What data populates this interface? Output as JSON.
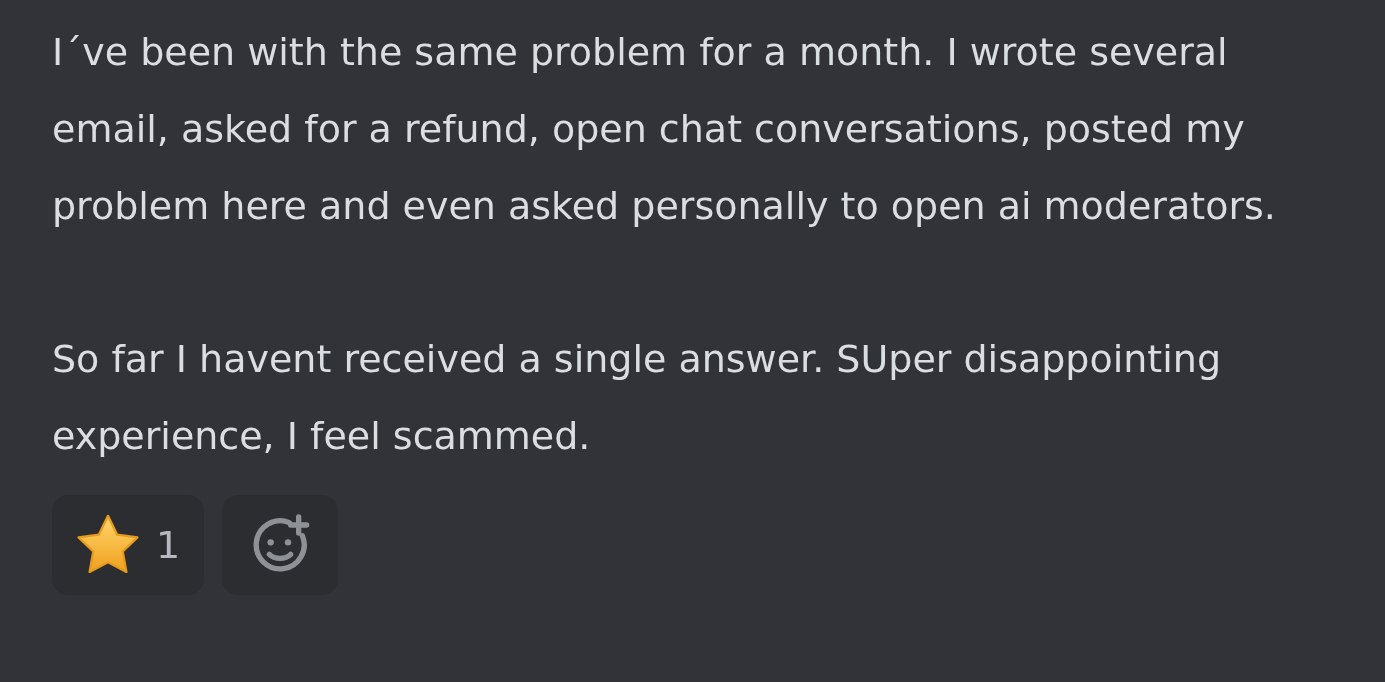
{
  "message": {
    "paragraphs": [
      "I´ve been with the same problem for a month. I wrote several email, asked for a refund, open chat conversations, posted my problem here and even asked personally to open ai moderators.",
      "So far I havent received a single answer. SUper disappointing experience, I feel scammed."
    ]
  },
  "reactions": [
    {
      "count": "1"
    }
  ]
}
